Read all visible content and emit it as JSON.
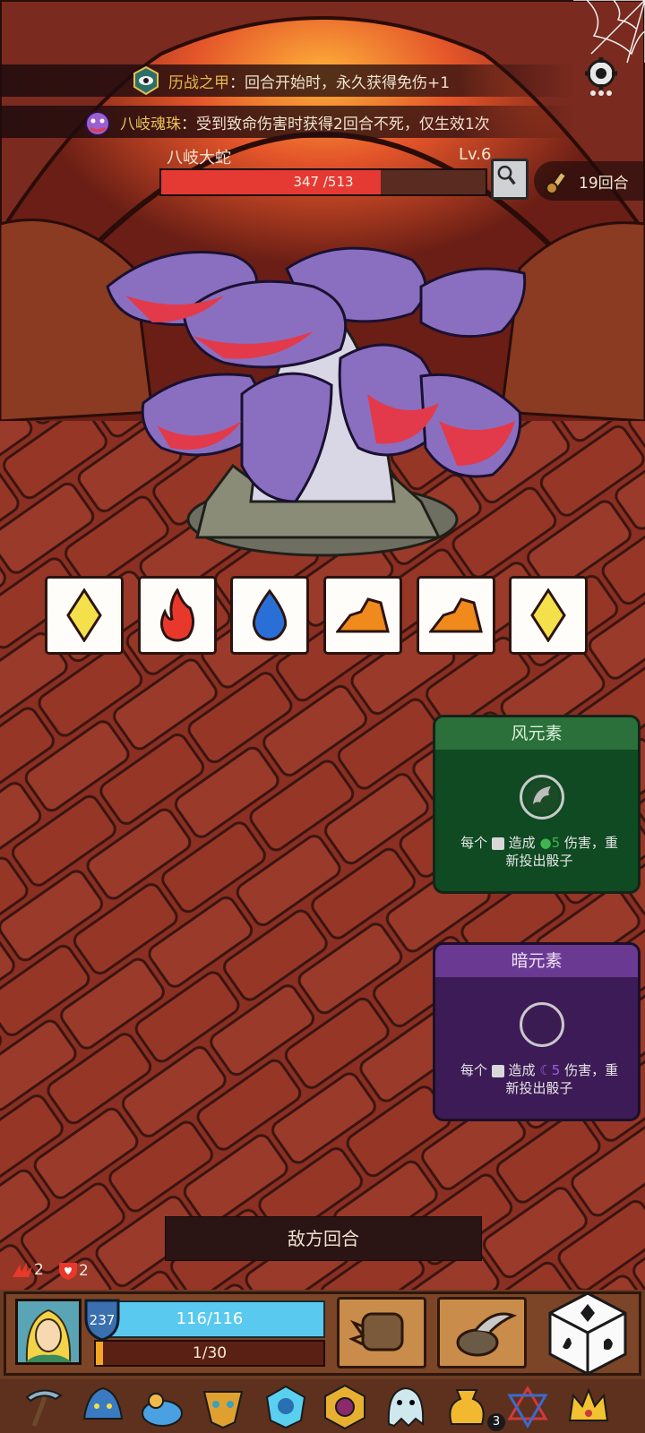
{
  "buffs": [
    {
      "name": "历战之甲",
      "text": "：回合开始时，永久获得免伤+1",
      "icon": "armor-eye-badge-icon"
    },
    {
      "name": "八岐魂珠",
      "text": "：受到致命伤害时获得2回合不死，仅生效1次",
      "icon": "purple-serpent-head-icon"
    }
  ],
  "boss": {
    "name": "八岐大蛇",
    "level": "Lv.6",
    "hp_text": "347 /513",
    "hp_fraction": 0.676
  },
  "turns_label": "19回合",
  "dice": [
    {
      "element": "light",
      "icon": "yellow-diamond-icon",
      "color": "#f4e04a"
    },
    {
      "element": "fire",
      "icon": "fire-icon",
      "color": "#e8382c"
    },
    {
      "element": "water",
      "icon": "water-drop-icon",
      "color": "#2a6fd6"
    },
    {
      "element": "earth",
      "icon": "earth-rock-icon",
      "color": "#f08a1c"
    },
    {
      "element": "earth",
      "icon": "earth-rock-icon",
      "color": "#f08a1c"
    },
    {
      "element": "light",
      "icon": "yellow-diamond-icon",
      "color": "#f4e04a"
    }
  ],
  "element_cards": [
    {
      "title": "风元素",
      "desc_line1": "每个",
      "desc_line1b": "造成",
      "desc_num": "5",
      "desc_line1c": "伤害，重",
      "desc_line2": "新投出骰子",
      "icon": "wind-element-icon"
    },
    {
      "title": "暗元素",
      "desc_line1": "每个",
      "desc_line1b": "造成",
      "desc_num": "5",
      "desc_line1c": "伤害，重",
      "desc_line2": "新投出骰子",
      "icon": "dark-moon-element-icon"
    }
  ],
  "enemy_turn_label": "敌方回合",
  "stats": {
    "attack": "2",
    "defense": "2"
  },
  "player": {
    "shield": "237",
    "hp_text": "116/116",
    "xp_text": "1/30",
    "xp_fraction": 0.033
  },
  "actions": [
    {
      "icon": "spiked-fist-icon"
    },
    {
      "icon": "scythe-sack-icon"
    }
  ],
  "relics": [
    {
      "icon": "pickaxe-relic-icon"
    },
    {
      "icon": "dragon-helm-relic-icon"
    },
    {
      "icon": "slime-relic-icon"
    },
    {
      "icon": "tribal-mask-relic-icon"
    },
    {
      "icon": "ice-crest-relic-icon"
    },
    {
      "icon": "hex-medallion-relic-icon"
    },
    {
      "icon": "ghost-relic-icon"
    },
    {
      "icon": "gold-sack-relic-icon"
    },
    {
      "icon": "hexagram-relic-icon"
    },
    {
      "icon": "gold-crown-relic-icon"
    }
  ],
  "relic_stack": "3"
}
